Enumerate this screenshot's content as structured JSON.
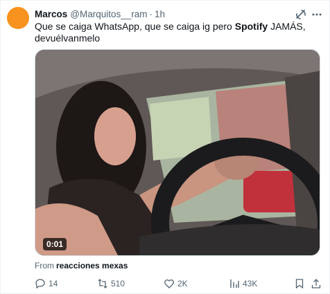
{
  "tweet": {
    "author_name": "Marcos",
    "handle": "@Marquitos__ram",
    "separator": "·",
    "time": "1h",
    "text_part1": "Que se caiga WhatsApp, que se caiga ig pero ",
    "text_bold": "Spotify",
    "text_part2": " JAMÁS,",
    "text_part3": "devuélvanmelo",
    "avatar_color": "#f7931e"
  },
  "media": {
    "duration": "0:01",
    "source_prefix": "From",
    "source_name": "reacciones mexas"
  },
  "actions": {
    "replies": "14",
    "reposts": "510",
    "likes": "2K",
    "views": "43K"
  },
  "icons": [
    "grok-icon",
    "more-icon",
    "reply-icon",
    "repost-icon",
    "like-icon",
    "views-icon",
    "bookmark-icon",
    "share-icon"
  ]
}
